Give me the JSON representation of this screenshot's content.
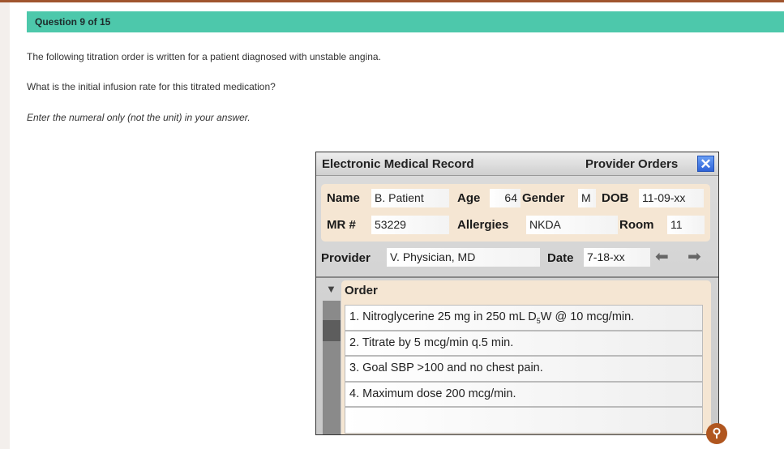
{
  "question": {
    "header": "Question 9 of 15",
    "line1": "The following titration order is written for a patient diagnosed with unstable angina.",
    "line2": "What is the initial infusion rate for this titrated medication?",
    "line3": "Enter the numeral only (not the unit) in your answer."
  },
  "emr": {
    "title": "Electronic Medical Record",
    "section": "Provider Orders",
    "close": "✕",
    "labels": {
      "name": "Name",
      "age": "Age",
      "gender": "Gender",
      "dob": "DOB",
      "mr": "MR #",
      "allergies": "Allergies",
      "room": "Room",
      "provider": "Provider",
      "date": "Date"
    },
    "values": {
      "name": "B. Patient",
      "age": "64",
      "gender": "M",
      "dob": "11-09-xx",
      "mr": "53229",
      "allergies": "NKDA",
      "room": "11",
      "provider": "V. Physician, MD",
      "date": "7-18-xx"
    },
    "order_title": "Order",
    "orders": [
      "1. Nitroglycerine 25 mg in 250 mL D",
      "W @ 10 mcg/min.",
      "2. Titrate by 5 mcg/min q.5 min.",
      "3. Goal SBP >100 and no chest pain.",
      "4. Maximum dose 200 mcg/min."
    ],
    "subscript": "5"
  }
}
